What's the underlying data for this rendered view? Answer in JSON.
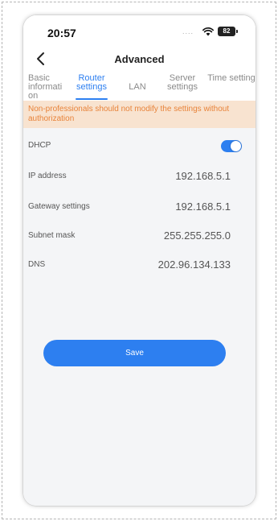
{
  "status_bar": {
    "time": "20:57",
    "signal_dots": "....",
    "battery": "82"
  },
  "nav": {
    "title": "Advanced",
    "back_icon": "chevron-left-icon"
  },
  "tabs": [
    {
      "label": "Basic informati on"
    },
    {
      "label": "Router settings"
    },
    {
      "label": "LAN"
    },
    {
      "label": "Server settings"
    },
    {
      "label": "Time setting"
    }
  ],
  "active_tab": "Router settings",
  "warning": "Non-professionals should not modify the settings without authorization",
  "rows": {
    "dhcp": {
      "label": "DHCP",
      "enabled": true
    },
    "ip": {
      "label": "IP address",
      "value": "192.168.5.1"
    },
    "gateway": {
      "label": "Gateway settings",
      "value": "192.168.5.1"
    },
    "subnet": {
      "label": "Subnet mask",
      "value": "255.255.255.0"
    },
    "dns": {
      "label": "DNS",
      "value": "202.96.134.133"
    }
  },
  "save_label": "Save",
  "colors": {
    "accent": "#2d7ff0",
    "warning_bg": "#f8e3d0",
    "warning_text": "#e8833a",
    "page_bg": "#f4f5f7"
  }
}
